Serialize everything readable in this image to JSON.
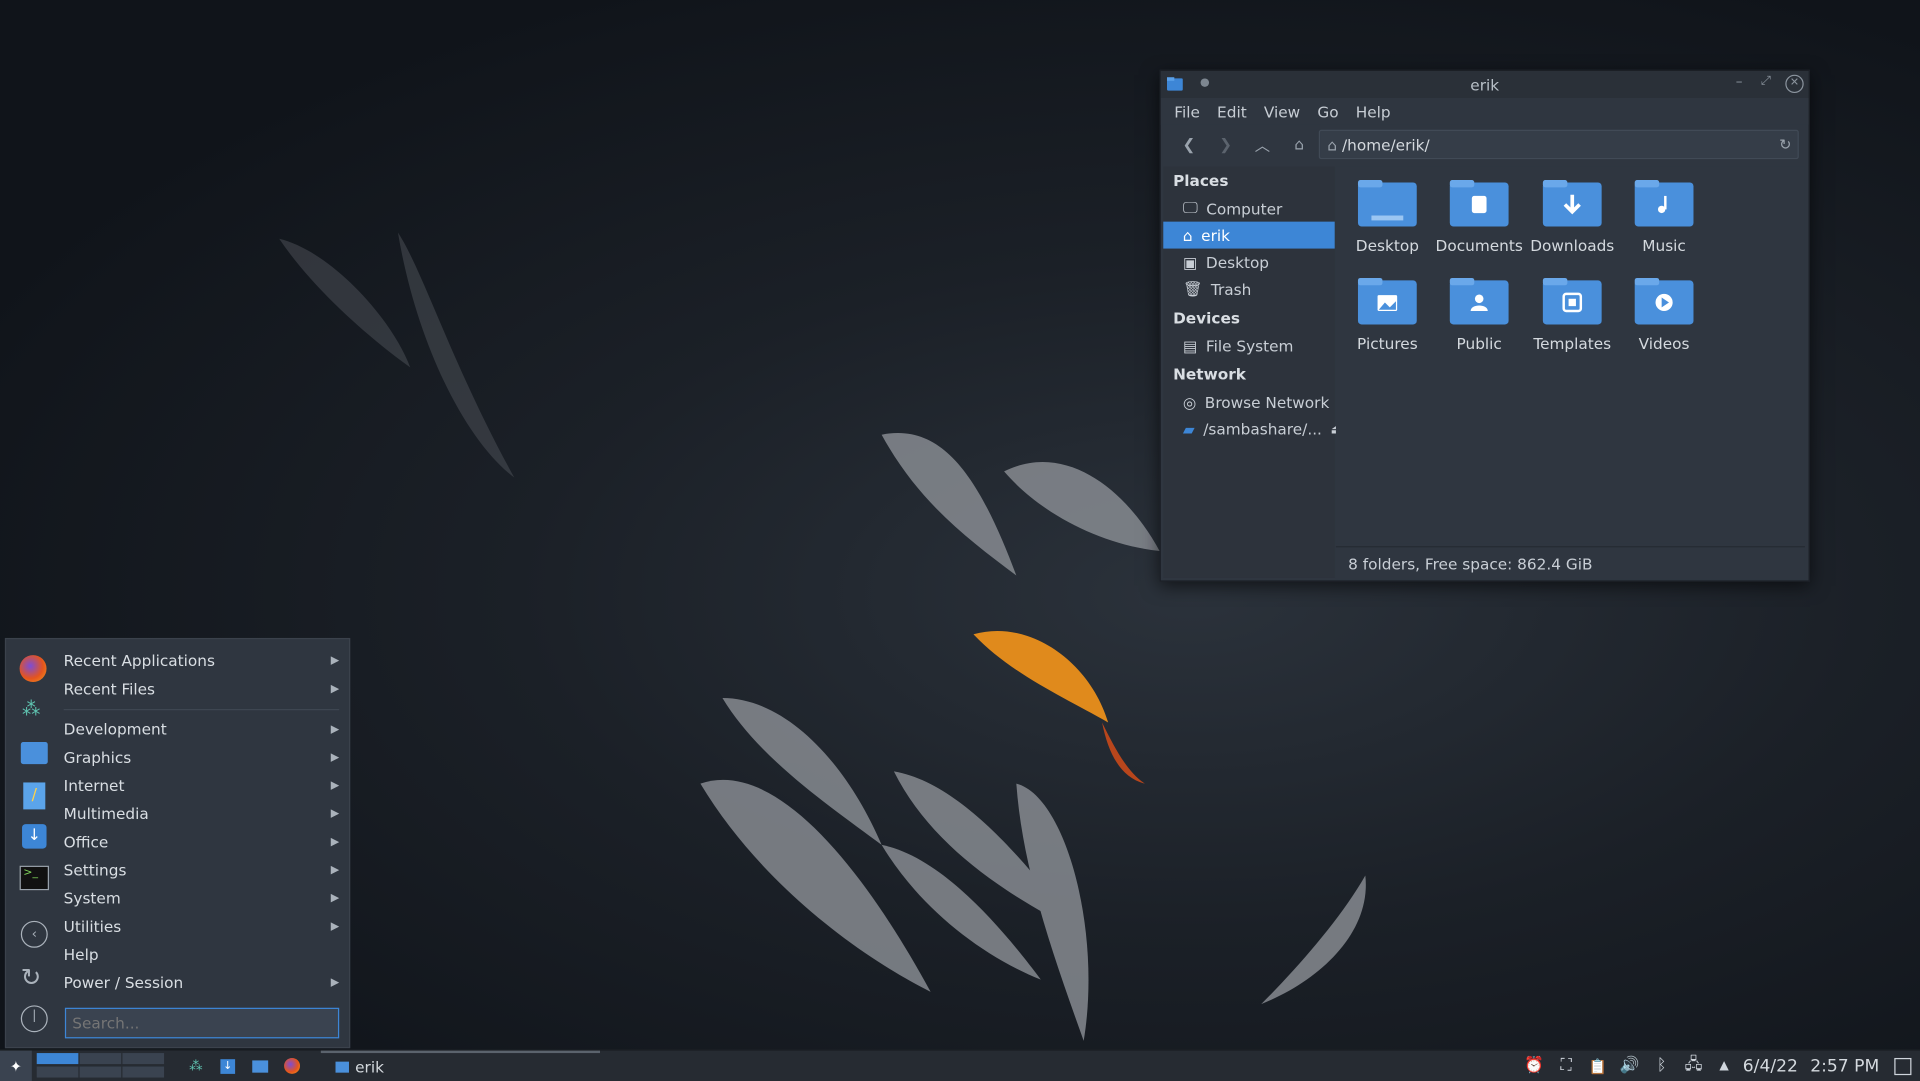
{
  "file_manager": {
    "title": "erik",
    "menus": [
      "File",
      "Edit",
      "View",
      "Go",
      "Help"
    ],
    "path": "/home/erik/",
    "places_header": "Places",
    "places": [
      {
        "label": "Computer",
        "icon": "monitor-icon"
      },
      {
        "label": "erik",
        "icon": "home-icon",
        "selected": true
      },
      {
        "label": "Desktop",
        "icon": "desktop-icon"
      },
      {
        "label": "Trash",
        "icon": "trash-icon"
      }
    ],
    "devices_header": "Devices",
    "devices": [
      {
        "label": "File System",
        "icon": "drive-icon"
      }
    ],
    "network_header": "Network",
    "network": [
      {
        "label": "Browse Network",
        "icon": "network-icon"
      },
      {
        "label": "/sambashare/...",
        "icon": "share-icon"
      }
    ],
    "folders": [
      "Desktop",
      "Documents",
      "Downloads",
      "Music",
      "Pictures",
      "Public",
      "Templates",
      "Videos"
    ],
    "status": "8 folders, Free space: 862.4 GiB",
    "accent": "#3d86d6"
  },
  "app_menu": {
    "items": [
      {
        "label": "Recent Applications",
        "submenu": true
      },
      {
        "label": "Recent Files",
        "submenu": true
      },
      {
        "label": "Development",
        "submenu": true
      },
      {
        "label": "Graphics",
        "submenu": true
      },
      {
        "label": "Internet",
        "submenu": true
      },
      {
        "label": "Multimedia",
        "submenu": true
      },
      {
        "label": "Office",
        "submenu": true
      },
      {
        "label": "Settings",
        "submenu": true
      },
      {
        "label": "System",
        "submenu": true
      },
      {
        "label": "Utilities",
        "submenu": true
      },
      {
        "label": "Help",
        "submenu": false
      },
      {
        "label": "Power / Session",
        "submenu": true
      }
    ],
    "search_placeholder": "Search..."
  },
  "taskbar": {
    "task_label": "erik",
    "date": "6/4/22",
    "time": "2:57 PM"
  }
}
